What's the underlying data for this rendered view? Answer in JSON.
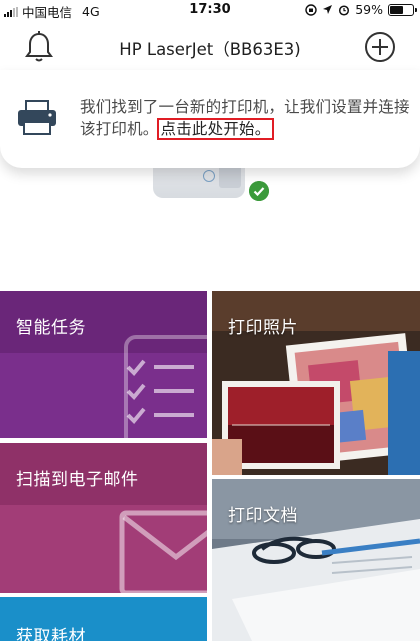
{
  "status_bar": {
    "carrier": "中国电信",
    "network": "4G",
    "time": "17:30",
    "battery": "59%",
    "battery_level": 0.59
  },
  "header": {
    "title": "HP LaserJet（BB63E3)"
  },
  "notice": {
    "message": "我们找到了一台新的打印机，让我们设置并连接该打印机。",
    "link": "点击此处开始。"
  },
  "tiles": {
    "smart_tasks": "智能任务",
    "print_photos": "打印照片",
    "scan_to_email": "扫描到电子邮件",
    "print_documents": "打印文档",
    "get_supplies": "获取耗材"
  },
  "colors": {
    "smart_tasks": "#7a2f8c",
    "scan_to_email": "#a23d77",
    "get_supplies": "#1a8fc9",
    "link_highlight": "#e01d25",
    "connected_check": "#3b9a3b"
  }
}
